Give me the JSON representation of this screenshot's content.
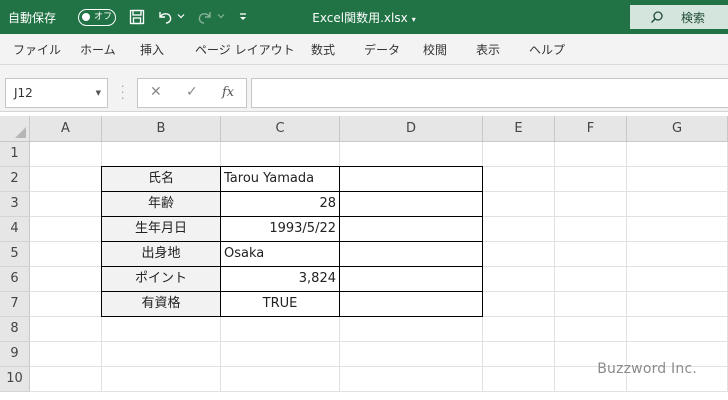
{
  "titlebar": {
    "autosave_label": "自動保存",
    "autosave_state": "オフ",
    "doc_title": "Excel関数用.xlsx",
    "doc_title_caret": "▾",
    "search_label": "検索",
    "icons": [
      "save-icon",
      "undo-icon",
      "redo-icon",
      "customize-qat-icon"
    ]
  },
  "ribbon": {
    "tabs": [
      "ファイル",
      "ホーム",
      "挿入",
      "ページ レイアウト",
      "数式",
      "データ",
      "校閲",
      "表示",
      "ヘルプ"
    ]
  },
  "formula_bar": {
    "name_box": "J12",
    "cancel_glyph": "✕",
    "enter_glyph": "✓",
    "fx_label": "fx",
    "formula": ""
  },
  "sheet": {
    "columns": [
      "A",
      "B",
      "C",
      "D",
      "E",
      "F",
      "G"
    ],
    "rows": [
      "1",
      "2",
      "3",
      "4",
      "5",
      "6",
      "7",
      "8",
      "9",
      "10"
    ],
    "table": [
      {
        "label": "氏名",
        "value": "Tarou Yamada"
      },
      {
        "label": "年齢",
        "value": "28"
      },
      {
        "label": "生年月日",
        "value": "1993/5/22"
      },
      {
        "label": "出身地",
        "value": "Osaka"
      },
      {
        "label": "ポイント",
        "value": "3,824"
      },
      {
        "label": "有資格",
        "value": "TRUE"
      }
    ]
  },
  "watermark": "Buzzword Inc.",
  "colors": {
    "titlebar_bg": "#217346",
    "ribbon_bg": "#f3f3f3",
    "header_bg": "#e6e6e6",
    "label_cell_bg": "#f2f2f2"
  }
}
